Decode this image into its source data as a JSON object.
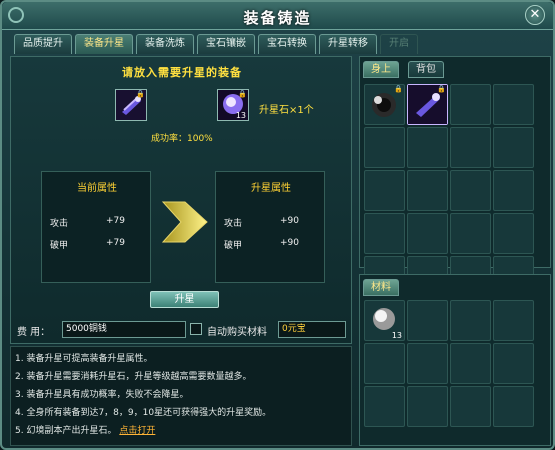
{
  "window": {
    "title": "装备铸造",
    "close_glyph": "✕"
  },
  "tabs": [
    {
      "label": "品质提升",
      "active": false
    },
    {
      "label": "装备升星",
      "active": true
    },
    {
      "label": "装备洗炼",
      "active": false
    },
    {
      "label": "宝石镶嵌",
      "active": false
    },
    {
      "label": "宝石转换",
      "active": false
    },
    {
      "label": "升星转移",
      "active": false
    },
    {
      "label": "开启",
      "active": false,
      "disabled": true
    }
  ],
  "upgrade": {
    "heading": "请放入需要升星的装备",
    "stone_label": "升星石×1个",
    "stone_count": "13",
    "success_rate": "成功率：100%"
  },
  "current_attrs": {
    "title": "当前属性",
    "rows": [
      {
        "name": "攻击",
        "value": "+79"
      },
      {
        "name": "破甲",
        "value": "+79"
      }
    ]
  },
  "next_attrs": {
    "title": "升星属性",
    "rows": [
      {
        "name": "攻击",
        "value": "+90"
      },
      {
        "name": "破甲",
        "value": "+90"
      }
    ]
  },
  "actions": {
    "upgrade_button": "升星"
  },
  "fee": {
    "label": "费   用：",
    "value": "5000铜钱",
    "auto_buy_label": "自动购买材料",
    "auto_buy_checked": false,
    "yuanbao": "0元宝"
  },
  "tips": [
    "1. 装备升星可提高装备升星属性。",
    "2. 装备升星需要消耗升星石，升星等级越高需要数量越多。",
    "3. 装备升星具有成功概率，失败不会降星。",
    "4. 全身所有装备到达7，8，9，10星还可获得强大的升星奖励。",
    "5. 幻境副本产出升星石。"
  ],
  "tip_link": "点击打开",
  "bag": {
    "tabs": [
      {
        "label": "身上",
        "active": true
      },
      {
        "label": "背包",
        "active": false
      }
    ],
    "rows": 5,
    "cols": 4
  },
  "materials": {
    "tab": "材料",
    "stone_count": "13",
    "rows": 3,
    "cols": 4
  },
  "colors": {
    "accent": "#ffe040",
    "panel": "#0f2a2c",
    "border": "#3e6b66"
  }
}
